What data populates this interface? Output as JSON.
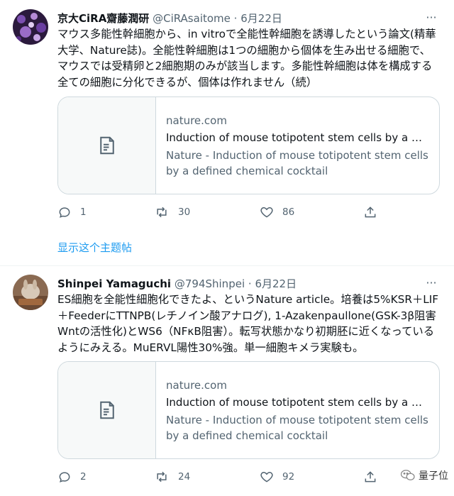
{
  "tweets": [
    {
      "author_name": "京大CiRA齋藤潤研",
      "handle": "@CiRAsaitome",
      "separator": "·",
      "date": "6月22日",
      "text": "マウス多能性幹細胞から、in vitroで全能性幹細胞を誘導したという論文(精華大学、Nature誌)。全能性幹細胞は1つの細胞から個体を生み出せる細胞で、マウスでは受精卵と2細胞期のみが該当します。多能性幹細胞は体を構成する全ての細胞に分化できるが、個体は作れません（続）",
      "card": {
        "domain": "nature.com",
        "title": "Induction of mouse totipotent stem cells by a defi...",
        "description": "Nature - Induction of mouse totipotent stem cells by a defined chemical cocktail"
      },
      "replies": "1",
      "retweets": "30",
      "likes": "86",
      "show_thread": "显示这个主题帖"
    },
    {
      "author_name": "Shinpei Yamaguchi",
      "handle": "@794Shinpei",
      "separator": "·",
      "date": "6月22日",
      "text": "ES細胞を全能性細胞化できたよ、というNature article。培養は5%KSR＋LIF＋FeederにTTNPB(レチノイン酸アナログ), 1-Azakenpaullone(GSK-3β阻害Wntの活性化)とWS6（NFκB阻害）。転写状態かなり初期胚に近くなっているようにみえる。MuERVL陽性30%強。単一細胞キメラ実験も。",
      "card": {
        "domain": "nature.com",
        "title": "Induction of mouse totipotent stem cells by a defi...",
        "description": "Nature - Induction of mouse totipotent stem cells by a defined chemical cocktail"
      },
      "replies": "2",
      "retweets": "24",
      "likes": "92"
    }
  ],
  "more_icon": "···",
  "watermark": {
    "text": "量子位",
    "icon": "wechat-icon"
  },
  "colors": {
    "link": "#1d9bf0",
    "muted": "#536471",
    "border": "#cfd9de"
  }
}
